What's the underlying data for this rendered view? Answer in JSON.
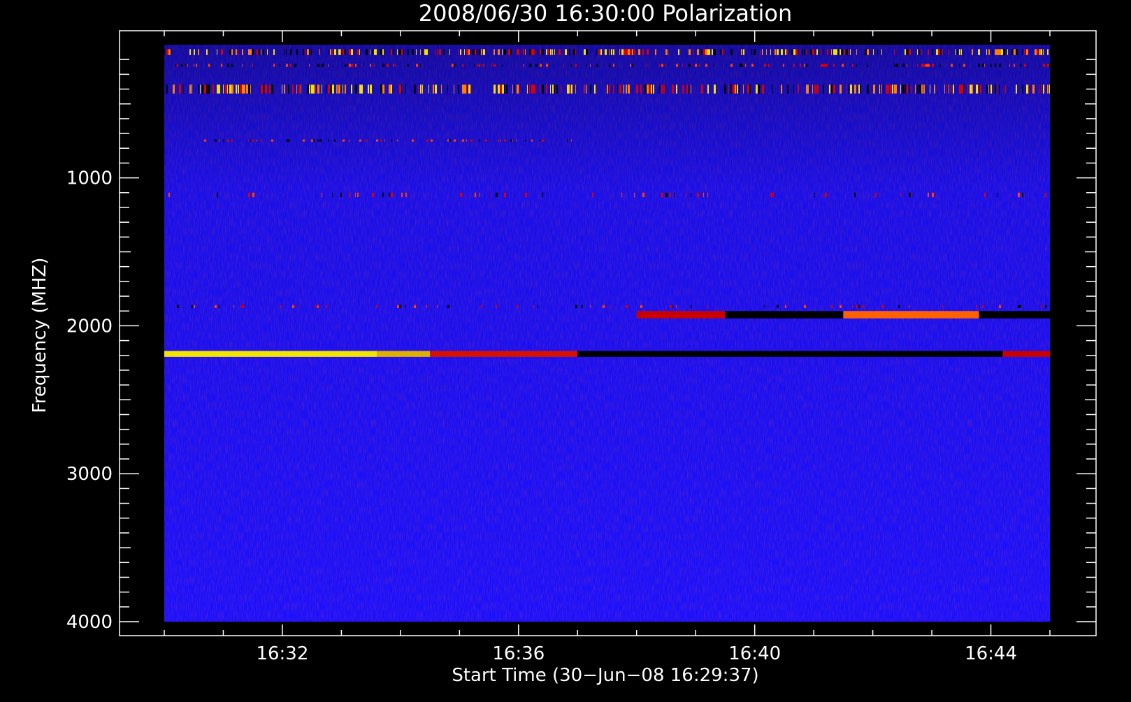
{
  "chart_data": {
    "type": "heatmap",
    "title": "2008/06/30 16:30:00 Polarization",
    "xlabel": "Start Time (30−Jun−08 16:29:37)",
    "ylabel": "Frequency (MHZ)",
    "x_tick_labels": [
      "16:32",
      "16:36",
      "16:40",
      "16:44"
    ],
    "x_tick_minutes": [
      32,
      36,
      40,
      44
    ],
    "xlim_minutes": [
      30,
      45
    ],
    "y_tick_values": [
      1000,
      2000,
      3000,
      4000
    ],
    "ylim": [
      100,
      4000
    ],
    "y_inverted": true,
    "colors": {
      "background": "#000000",
      "base": "#1a10ff",
      "warm": "#d80000",
      "hot": "#f5e000",
      "cold": "#000000"
    },
    "features": [
      {
        "label": "bright polarized band",
        "freq_start": 2170,
        "freq_end": 2210,
        "time_start": 30.0,
        "time_end": 45.0,
        "segments": [
          {
            "t0": 30.0,
            "t1": 33.6,
            "color": "#f2e600"
          },
          {
            "t0": 33.6,
            "t1": 34.5,
            "color": "#e0b000"
          },
          {
            "t0": 34.5,
            "t1": 37.0,
            "color": "#d81000"
          },
          {
            "t0": 37.0,
            "t1": 44.2,
            "color": "#000000"
          },
          {
            "t0": 44.2,
            "t1": 45.0,
            "color": "#c80000"
          }
        ]
      },
      {
        "label": "secondary band",
        "freq_start": 1900,
        "freq_end": 1950,
        "time_start": 38.0,
        "time_end": 45.0,
        "segments": [
          {
            "t0": 38.0,
            "t1": 39.5,
            "color": "#c80000"
          },
          {
            "t0": 39.5,
            "t1": 41.5,
            "color": "#000000"
          },
          {
            "t0": 41.5,
            "t1": 43.8,
            "color": "#ff6000"
          },
          {
            "t0": 43.8,
            "t1": 45.0,
            "color": "#000000"
          }
        ]
      },
      {
        "label": "interference band",
        "freq_start": 370,
        "freq_end": 430,
        "time_start": 30.0,
        "time_end": 45.0,
        "intensity": "high"
      },
      {
        "label": "interference band",
        "freq_start": 130,
        "freq_end": 170,
        "time_start": 30.0,
        "time_end": 45.0,
        "intensity": "high"
      },
      {
        "label": "interference band",
        "freq_start": 230,
        "freq_end": 250,
        "time_start": 30.0,
        "time_end": 45.0,
        "intensity": "medium"
      },
      {
        "label": "interference line",
        "freq_start": 740,
        "freq_end": 755,
        "time_start": 30.0,
        "time_end": 37.0,
        "intensity": "medium"
      },
      {
        "label": "sparse band",
        "freq_start": 1100,
        "freq_end": 1130,
        "time_start": 30.0,
        "time_end": 45.0,
        "intensity": "low"
      },
      {
        "label": "sparse band",
        "freq_start": 1860,
        "freq_end": 1880,
        "time_start": 30.0,
        "time_end": 45.0,
        "intensity": "low"
      }
    ],
    "grid": false,
    "legend": "none"
  }
}
